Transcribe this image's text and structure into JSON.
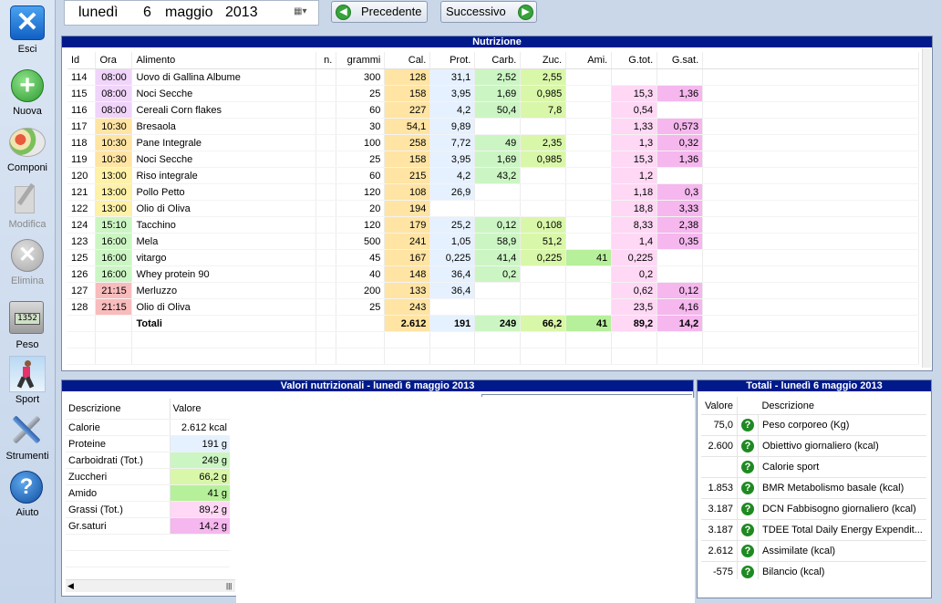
{
  "sidebar": {
    "items": [
      {
        "label": "Esci",
        "icon": "close-icon"
      },
      {
        "label": "Nuova",
        "icon": "add-icon"
      },
      {
        "label": "Componi",
        "icon": "food-plate-icon"
      },
      {
        "label": "Modifica",
        "icon": "edit-icon"
      },
      {
        "label": "Elimina",
        "icon": "delete-icon"
      },
      {
        "label": "Peso",
        "icon": "scale-icon"
      },
      {
        "label": "Sport",
        "icon": "runner-icon"
      },
      {
        "label": "Strumenti",
        "icon": "tools-icon"
      },
      {
        "label": "Aiuto",
        "icon": "help-icon"
      }
    ]
  },
  "date": {
    "weekday": "lunedì",
    "day": "6",
    "month": "maggio",
    "year": "2013"
  },
  "nav": {
    "prev": "Precedente",
    "next": "Successivo"
  },
  "nutrition": {
    "title": "Nutrizione",
    "columns": [
      "Id",
      "Ora",
      "Alimento",
      "n.",
      "grammi",
      "Cal.",
      "Prot.",
      "Carb.",
      "Zuc.",
      "Ami.",
      "G.tot.",
      "G.sat."
    ],
    "rows": [
      [
        "114",
        "08:00",
        "Uovo di Gallina Albume",
        "",
        "300",
        "128",
        "31,1",
        "2,52",
        "2,55",
        "",
        "",
        ""
      ],
      [
        "115",
        "08:00",
        "Noci Secche",
        "",
        "25",
        "158",
        "3,95",
        "1,69",
        "0,985",
        "",
        "15,3",
        "1,36"
      ],
      [
        "116",
        "08:00",
        "Cereali Corn flakes",
        "",
        "60",
        "227",
        "4,2",
        "50,4",
        "7,8",
        "",
        "0,54",
        ""
      ],
      [
        "117",
        "10:30",
        "Bresaola",
        "",
        "30",
        "54,1",
        "9,89",
        "",
        "",
        "",
        "1,33",
        "0,573"
      ],
      [
        "118",
        "10:30",
        "Pane Integrale",
        "",
        "100",
        "258",
        "7,72",
        "49",
        "2,35",
        "",
        "1,3",
        "0,32"
      ],
      [
        "119",
        "10:30",
        "Noci Secche",
        "",
        "25",
        "158",
        "3,95",
        "1,69",
        "0,985",
        "",
        "15,3",
        "1,36"
      ],
      [
        "120",
        "13:00",
        "Riso integrale",
        "",
        "60",
        "215",
        "4,2",
        "43,2",
        "",
        "",
        "1,2",
        ""
      ],
      [
        "121",
        "13:00",
        "Pollo Petto",
        "",
        "120",
        "108",
        "26,9",
        "",
        "",
        "",
        "1,18",
        "0,3"
      ],
      [
        "122",
        "13:00",
        "Olio di Oliva",
        "",
        "20",
        "194",
        "",
        "",
        "",
        "",
        "18,8",
        "3,33"
      ],
      [
        "124",
        "15:10",
        "Tacchino",
        "",
        "120",
        "179",
        "25,2",
        "0,12",
        "0,108",
        "",
        "8,33",
        "2,38"
      ],
      [
        "123",
        "16:00",
        "Mela",
        "",
        "500",
        "241",
        "1,05",
        "58,9",
        "51,2",
        "",
        "1,4",
        "0,35"
      ],
      [
        "125",
        "16:00",
        "vitargo",
        "",
        "45",
        "167",
        "0,225",
        "41,4",
        "0,225",
        "41",
        "0,225",
        ""
      ],
      [
        "126",
        "16:00",
        "Whey protein 90",
        "",
        "40",
        "148",
        "36,4",
        "0,2",
        "",
        "",
        "0,2",
        ""
      ],
      [
        "127",
        "21:15",
        "Merluzzo",
        "",
        "200",
        "133",
        "36,4",
        "",
        "",
        "",
        "0,62",
        "0,12"
      ],
      [
        "128",
        "21:15",
        "Olio di Oliva",
        "",
        "25",
        "243",
        "",
        "",
        "",
        "",
        "23,5",
        "4,16"
      ]
    ],
    "totals_label": "Totali",
    "totals": [
      "2.612",
      "191",
      "249",
      "66,2",
      "41",
      "89,2",
      "14,2"
    ]
  },
  "values_panel": {
    "title": "Valori nutrizionali - lunedì 6 maggio 2013",
    "col_desc": "Descrizione",
    "col_val": "Valore",
    "rows": [
      {
        "desc": "Calorie",
        "val": "2.612 kcal"
      },
      {
        "desc": "Proteine",
        "val": "191 g"
      },
      {
        "desc": "Carboidrati (Tot.)",
        "val": "249 g"
      },
      {
        "desc": "Zuccheri",
        "val": "66,2 g"
      },
      {
        "desc": "Amido",
        "val": "41 g"
      },
      {
        "desc": "Grassi (Tot.)",
        "val": "89,2 g"
      },
      {
        "desc": "Gr.saturi",
        "val": "14,2 g"
      }
    ]
  },
  "totals_panel": {
    "title": "Totali - lunedì 6 maggio 2013",
    "col_val": "Valore",
    "col_desc": "Descrizione",
    "rows": [
      {
        "val": "75,0",
        "desc": "Peso corporeo (Kg)"
      },
      {
        "val": "2.600",
        "desc": "Obiettivo giornaliero (kcal)"
      },
      {
        "val": "",
        "desc": "Calorie sport"
      },
      {
        "val": "1.853",
        "desc": "BMR Metabolismo basale (kcal)"
      },
      {
        "val": "3.187",
        "desc": "DCN Fabbisogno giornaliero (kcal)"
      },
      {
        "val": "3.187",
        "desc": "TDEE Total Daily Energy Expendit..."
      },
      {
        "val": "2.612",
        "desc": "Assimilate (kcal)"
      },
      {
        "val": "-575",
        "desc": "Bilancio (kcal)"
      }
    ]
  }
}
